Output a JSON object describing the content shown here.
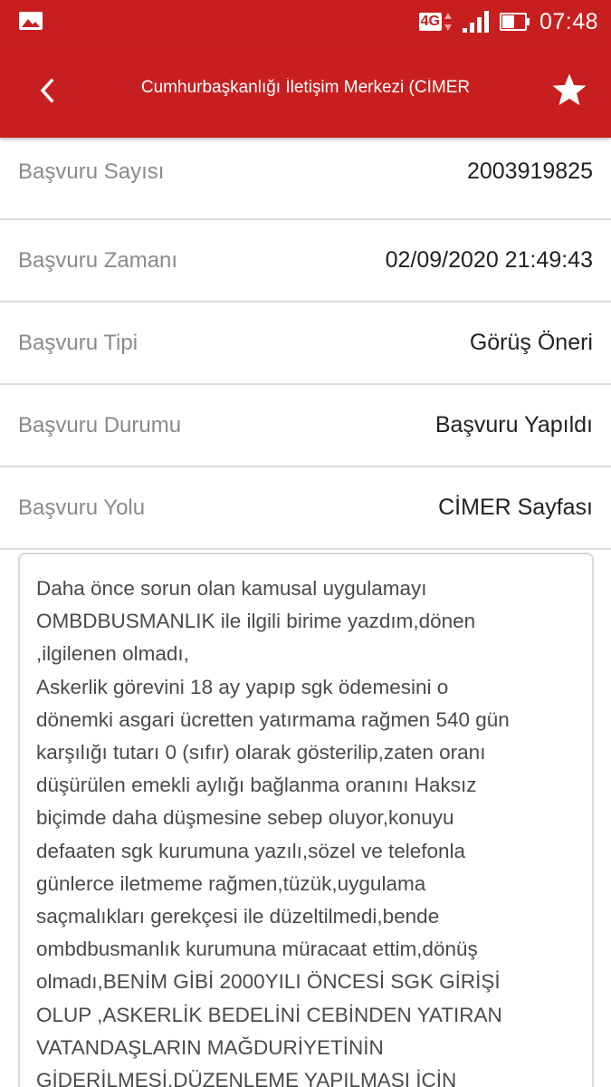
{
  "status_bar": {
    "network": "4G",
    "time": "07:48",
    "icons": [
      "image-icon",
      "network-4g-icon",
      "signal-icon",
      "battery-icon"
    ]
  },
  "app_bar": {
    "title": "Cumhurbaşkanlığı İletişim Merkezi (CİMER",
    "icons": [
      "back-arrow-icon",
      "star-icon"
    ]
  },
  "colors": {
    "primary": "#c71f1f",
    "label": "#8a8a8a",
    "value": "#222222",
    "divider": "#dcdcdc"
  },
  "details": [
    {
      "label": "Başvuru Sayısı",
      "value": "2003919825"
    },
    {
      "label": "Başvuru Zamanı",
      "value": "02/09/2020 21:49:43"
    },
    {
      "label": "Başvuru Tipi",
      "value": "Görüş Öneri"
    },
    {
      "label": "Başvuru Durumu",
      "value": "Başvuru Yapıldı"
    },
    {
      "label": "Başvuru Yolu",
      "value": "CİMER Sayfası"
    }
  ],
  "message": "Daha önce sorun olan kamusal uygulamayı\nOMBDBUSMANLIK ile ilgili birime yazdım,dönen\n,ilgilenen olmadı,\nAskerlik görevini 18 ay yapıp sgk ödemesini o\ndönemki asgari ücretten yatırmama rağmen 540 gün\nkarşılığı tutarı 0 (sıfır) olarak gösterilip,zaten oranı\ndüşürülen emekli aylığı bağlanma oranını Haksız\nbiçimde daha düşmesine sebep oluyor,konuyu\ndefaaten sgk kurumuna yazılı,sözel ve telefonla\ngünlerce iletmeme rağmen,tüzük,uygulama\nsaçmalıkları gerekçesi ile düzeltilmedi,bende\nombdbusmanlık kurumuna müracaat ettim,dönüş\nolmadı,BENİM GİBİ 2000YILI ÖNCESİ SGK GİRİŞİ\nOLUP ,ASKERLİK BEDELİNİ CEBİNDEN YATIRAN\nVATANDAŞLARIN MAĞDURİYETİNİN\nGİDERİLMESİ,DÜZENLEME YAPILMASI İÇİN"
}
